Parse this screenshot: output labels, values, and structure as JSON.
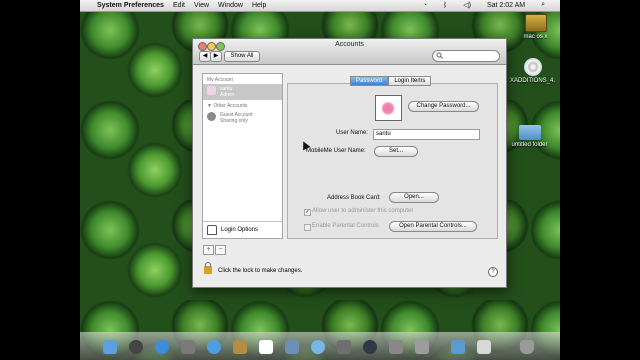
{
  "menubar": {
    "apple_icon": "apple-icon",
    "app_name": "System Preferences",
    "menus": [
      "Edit",
      "View",
      "Window",
      "Help"
    ],
    "clock": "Sat 2:02 AM",
    "status_icons": [
      "wifi-icon",
      "bluetooth-icon",
      "volume-icon",
      "spotlight-icon"
    ]
  },
  "desktop": {
    "items": [
      {
        "label": "mac os x",
        "icon": "hard-drive-icon"
      },
      {
        "label": "XADDITIONS_4.",
        "icon": "cd-icon"
      },
      {
        "label": "untitled folder",
        "icon": "folder-icon"
      }
    ]
  },
  "window": {
    "title": "Accounts",
    "toolbar": {
      "show_all": "Show All",
      "back_icon": "back-arrow-icon",
      "forward_icon": "forward-arrow-icon",
      "search_icon": "search-icon"
    },
    "left_panel": {
      "my_account_label": "My Account",
      "my_account": {
        "name": "santu",
        "role": "Admin"
      },
      "other_accounts_label": "Other Accounts",
      "guest": {
        "name": "Guest Account",
        "status": "Sharing only"
      },
      "login_options": "Login Options",
      "add_label": "+",
      "remove_label": "−"
    },
    "tabs": [
      "Password",
      "Login Items"
    ],
    "password_tab": {
      "change_password": "Change Password...",
      "user_name_label": "User Name:",
      "user_name_value": "santu",
      "mobileme_label": "MobileMe User Name:",
      "mobileme_button": "Set...",
      "address_book_label": "Address Book Card:",
      "address_book_button": "Open...",
      "allow_admin": "Allow user to administer this computer",
      "parental_controls": "Enable Parental Controls",
      "open_parental_controls": "Open Parental Controls..."
    },
    "footer": {
      "lock_text": "Click the lock to make changes.",
      "help": "?"
    }
  },
  "dock": {
    "items": [
      "finder-icon",
      "dashboard-icon",
      "safari-icon",
      "mail-icon",
      "ichat-icon",
      "address-book-icon",
      "ical-icon",
      "preview-icon",
      "itunes-icon",
      "spaces-icon",
      "time-machine-icon",
      "system-preferences-icon",
      "utility-icon",
      "documents-icon",
      "downloads-icon",
      "trash-icon"
    ]
  }
}
